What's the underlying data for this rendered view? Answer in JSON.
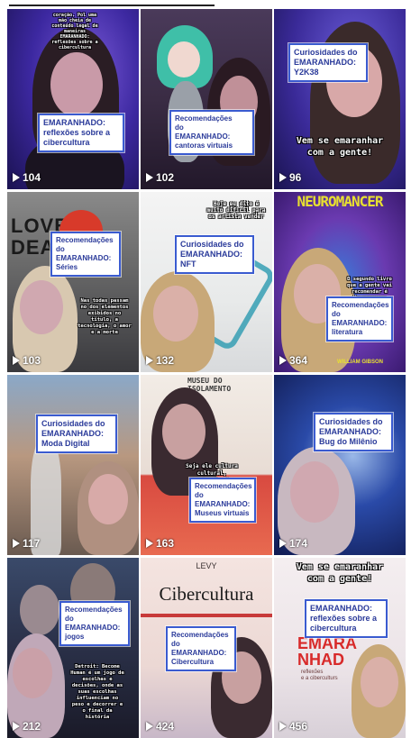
{
  "tiles": [
    {
      "views": "104",
      "card": "EMARANHADO:\nreflexões sobre a\ncibercultura",
      "caption": "coração. Pol uma\nmão cheia de\nconteúdo legal de\nmaneiras\nEMARANHADO:\nreflexões sobre a\ncibercultura"
    },
    {
      "views": "102",
      "card": "Recomendações\ndo\nEMARANHADO:\ncantoras virtuais",
      "caption": ""
    },
    {
      "views": "96",
      "card": "Curiosidades do\nEMARANHADO:\nY2K38",
      "caption": "Vem se emaranhar\ncom a gente!"
    },
    {
      "views": "103",
      "card": "Recomendações\ndo\nEMARANHADO:\nSéries",
      "caption": "Nas todas passam\nno dos elementos\nexibidos no\ntítulo, a\ntecnologia, o amor\ne a morte",
      "poster": "LOVE DEATH"
    },
    {
      "views": "132",
      "card": "Curiosidades do\nEMARANHADO:\nNFT",
      "caption": "Hoje eu dito é\nmuito difícil para\nos artista vender"
    },
    {
      "views": "364",
      "card": "Recomendações\ndo\nEMARANHADO:\nliteratura",
      "caption": "O segundo livro\nque a gente vai\nrecomendar é\nNeuromancer",
      "poster": "NEUROMANCER",
      "author": "WILLIAM GIBSON"
    },
    {
      "views": "117",
      "card": "Curiosidades do\nEMARANHADO:\nModa Digital",
      "caption": ""
    },
    {
      "views": "163",
      "card": "Recomendações\ndo\nEMARANHADO:\nMuseus virtuais",
      "caption": "Seja ele cultura\ncultural,\nregional, de",
      "poster": "MUSEU DO\nISOLAMENTO"
    },
    {
      "views": "174",
      "card": "Curiosidades do\nEMARANHADO:\nBug do Milênio",
      "caption": ""
    },
    {
      "views": "212",
      "card": "Recomendações\ndo\nEMARANHADO:\njogos",
      "caption": "Detroit: Become\nHuman é um jogo de\nescolhas e\ndecisões, onde as\nsuas escolhas\ninfluenciam no\npeso e decorrer e\no final da\nhistória"
    },
    {
      "views": "424",
      "card": "Recomendações\ndo\nEMARANHADO:\nCibercultura",
      "caption": "",
      "poster": "LEVY",
      "poster2": "Cibercultura"
    },
    {
      "views": "456",
      "card": "EMARANHADO:\nreflexões sobre a\ncibercultura",
      "caption": "Vem se emaranhar\ncom a gente!",
      "poster": "EMARA\nNHAD",
      "poster2": "reflexões\ne a ciberculturs"
    }
  ],
  "colors": {
    "card_border": "#3a5bd0",
    "card_text": "#2a3a9a"
  }
}
